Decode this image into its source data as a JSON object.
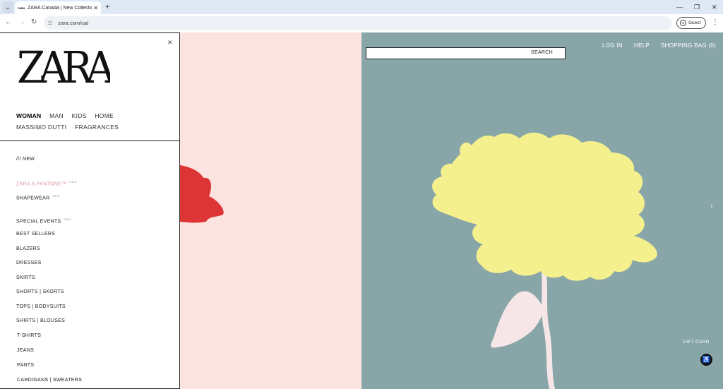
{
  "browser": {
    "tab_title": "ZARA Canada | New Collection",
    "tab_favicon": "ZARA",
    "url": "zara.com/ca/",
    "profile_label": "Guest"
  },
  "drawer": {
    "logo": "ZARA",
    "categories_row1": [
      "WOMAN",
      "MAN",
      "KIDS",
      "HOME"
    ],
    "categories_row2": [
      "MASSIMO DUTTI",
      "FRAGRANCES"
    ],
    "active_category": "WOMAN",
    "items": [
      {
        "label": "/// NEW",
        "tag": ""
      },
      {
        "label": "ZARA X PANTONE™",
        "tag": "NEW"
      },
      {
        "label": "SHAPEWEAR",
        "tag": "NEW"
      },
      {
        "label": "SPECIAL EVENTS",
        "tag": "NEW"
      },
      {
        "label": "BEST SELLERS",
        "tag": ""
      },
      {
        "label": "BLAZERS",
        "tag": ""
      },
      {
        "label": "DRESSES",
        "tag": ""
      },
      {
        "label": "SKIRTS",
        "tag": ""
      },
      {
        "label": "SHORTS | SKORTS",
        "tag": ""
      },
      {
        "label": "TOPS | BODYSUITS",
        "tag": ""
      },
      {
        "label": "SHIRTS | BLOUSES",
        "tag": ""
      },
      {
        "label": "T-SHIRTS",
        "tag": ""
      },
      {
        "label": "JEANS",
        "tag": ""
      },
      {
        "label": "PANTS",
        "tag": ""
      },
      {
        "label": "CARDIGANS | SWEATERS",
        "tag": ""
      }
    ]
  },
  "header": {
    "search_label": "SEARCH",
    "login": "LOG IN",
    "help": "HELP",
    "shopping_bag": "SHOPPING BAG (0)"
  },
  "footer": {
    "gift_card": "GIFT CARD"
  },
  "colors": {
    "pink_panel": "#fbe3df",
    "teal_panel": "#88a5a8",
    "flower_yellow": "#f5f08e",
    "flower_red": "#dd3535",
    "petal_pink": "#f6e6e8"
  },
  "icons": [
    "tab-search-icon",
    "close-icon",
    "plus-icon",
    "minimize-icon",
    "restore-icon",
    "back-icon",
    "forward-icon",
    "reload-icon",
    "site-info-icon",
    "profile-icon",
    "more-icon",
    "chevron-right-icon",
    "accessibility-icon"
  ]
}
